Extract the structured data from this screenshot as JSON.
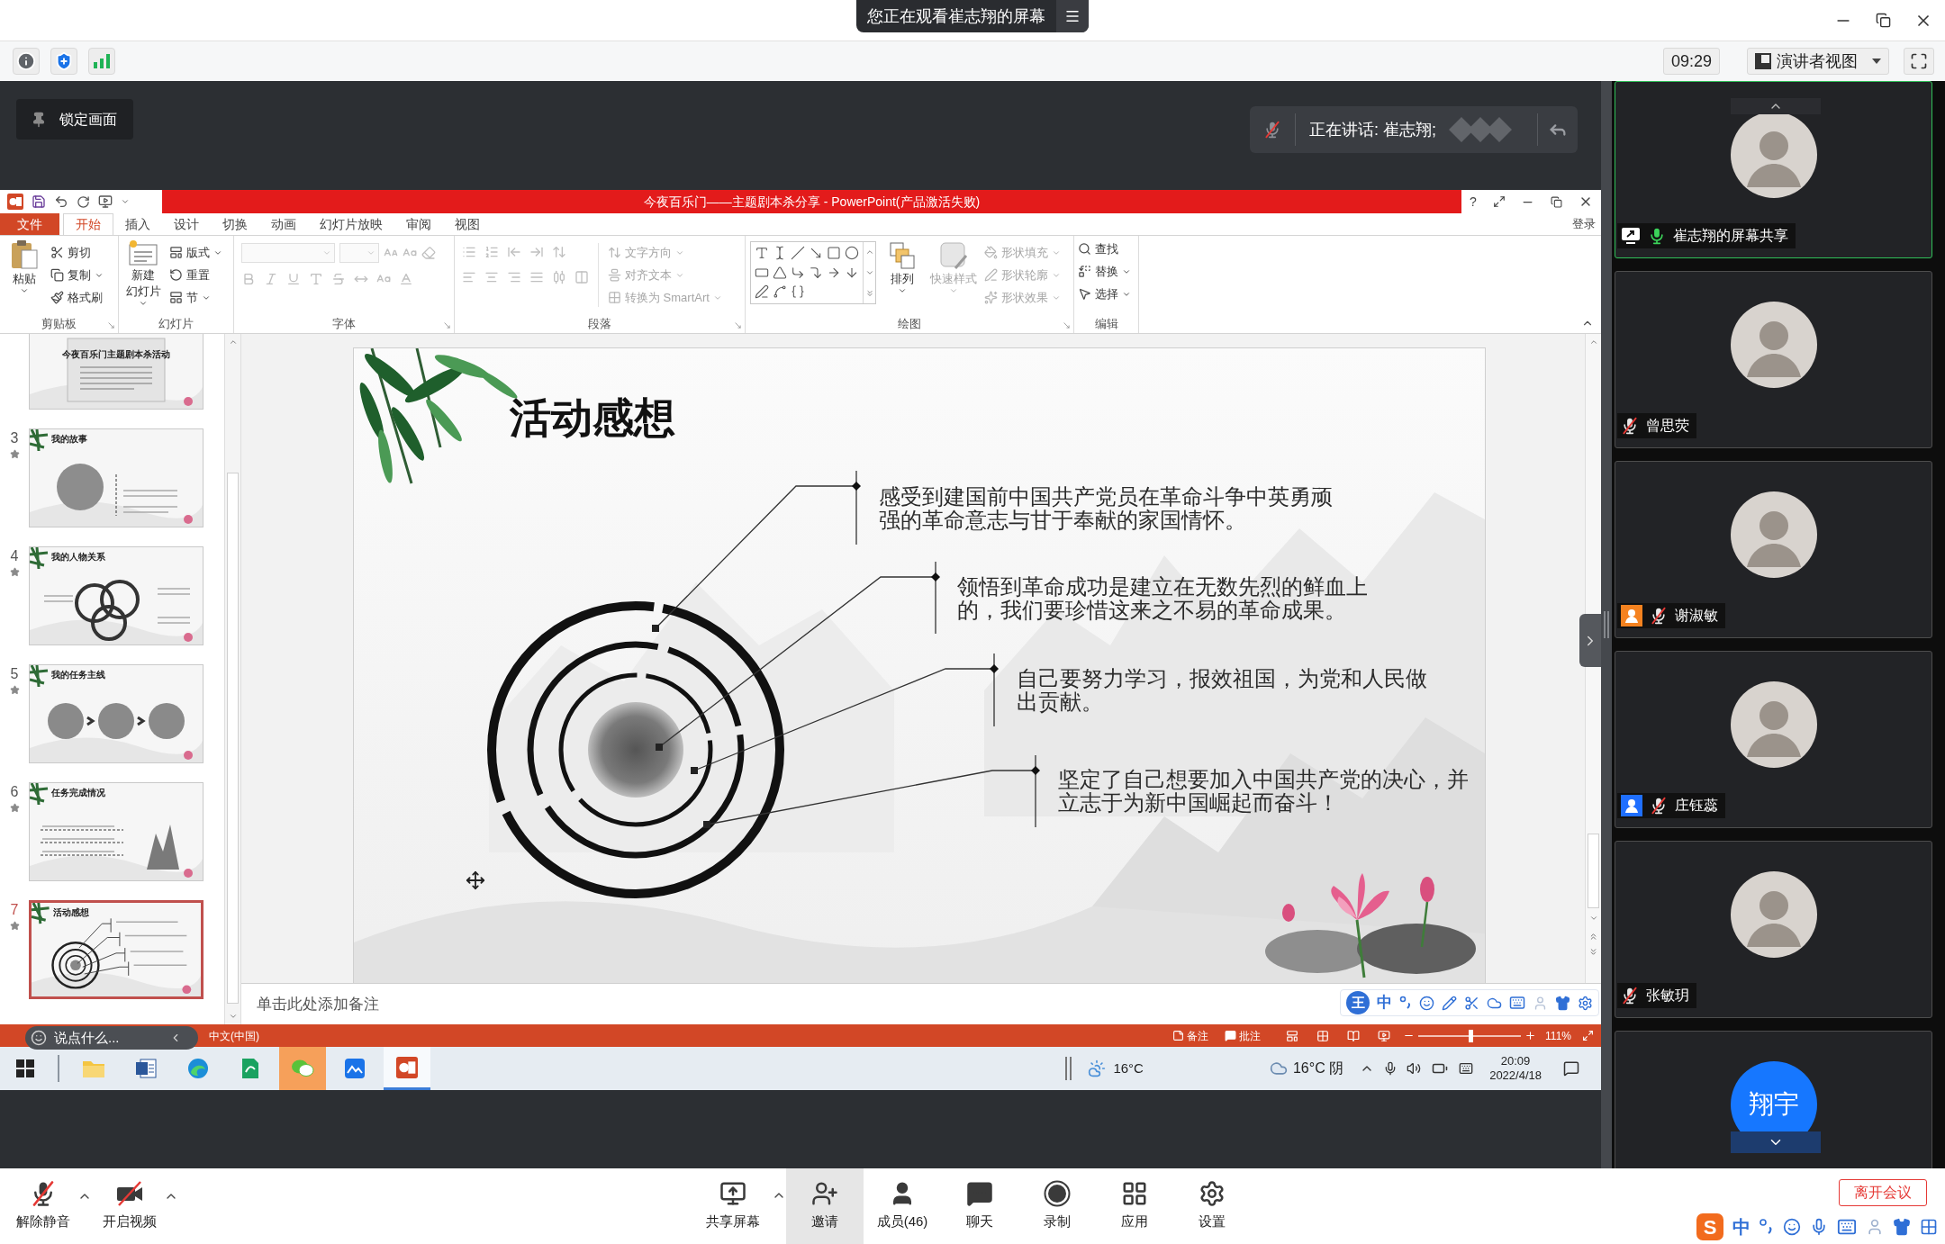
{
  "banner": {
    "text": "您正在观看崔志翔的屏幕"
  },
  "toolbar": {
    "time": "09:29",
    "view_menu": "演讲者视图"
  },
  "lock_button": "锁定画面",
  "speaker": {
    "text": "正在讲话: 崔志翔;",
    "muted": true
  },
  "powerpoint": {
    "title": "今夜百乐门——主题剧本杀分享 - PowerPoint(产品激活失败)",
    "help": "?",
    "tabs": [
      {
        "label": "文件",
        "kind": "file",
        "selected": false
      },
      {
        "label": "开始",
        "kind": "tab",
        "selected": true
      },
      {
        "label": "插入",
        "kind": "tab",
        "selected": false
      },
      {
        "label": "设计",
        "kind": "tab",
        "selected": false
      },
      {
        "label": "切换",
        "kind": "tab",
        "selected": false
      },
      {
        "label": "动画",
        "kind": "tab",
        "selected": false
      },
      {
        "label": "幻灯片放映",
        "kind": "tab",
        "selected": false
      },
      {
        "label": "审阅",
        "kind": "tab",
        "selected": false
      },
      {
        "label": "视图",
        "kind": "tab",
        "selected": false
      }
    ],
    "sign_in": "登录",
    "ribbon": [
      {
        "kind": "clipboard",
        "label": "剪贴板",
        "disabled": false,
        "large": [
          "粘贴"
        ],
        "items": [
          {
            "label": "剪切",
            "kind": "cut",
            "menu": false,
            "disabled": false
          },
          {
            "label": "复制",
            "kind": "copy",
            "menu": true,
            "disabled": false
          },
          {
            "label": "格式刷",
            "kind": "brush",
            "menu": false,
            "disabled": false
          }
        ]
      },
      {
        "kind": "slides",
        "label": "幻灯片",
        "disabled": false,
        "large": [
          "新建",
          "幻灯片"
        ],
        "items": [
          {
            "label": "版式",
            "kind": "layout",
            "menu": true,
            "disabled": false
          },
          {
            "label": "重置",
            "kind": "reset",
            "menu": false,
            "disabled": false
          },
          {
            "label": "节",
            "kind": "section",
            "menu": true,
            "disabled": false
          }
        ]
      },
      {
        "kind": "font",
        "label": "字体",
        "disabled": true
      },
      {
        "kind": "paragraph",
        "label": "段落",
        "disabled": true,
        "items": [
          {
            "label": "文字方向",
            "kind": "text-direction",
            "menu": true,
            "disabled": true
          },
          {
            "label": "对齐文本",
            "kind": "align-text",
            "menu": true,
            "disabled": true
          },
          {
            "label": "转换为 SmartArt",
            "kind": "smartart",
            "menu": true,
            "disabled": true
          }
        ]
      },
      {
        "kind": "drawing",
        "label": "绘图",
        "disabled": false,
        "large": [
          "排列"
        ],
        "quick_styles": {
          "label": "快速样式",
          "disabled": true
        },
        "items": [
          {
            "label": "形状填充",
            "kind": "fill",
            "menu": true,
            "disabled": true
          },
          {
            "label": "形状轮廓",
            "kind": "outline",
            "menu": true,
            "disabled": true
          },
          {
            "label": "形状效果",
            "kind": "effects",
            "menu": true,
            "disabled": true
          }
        ]
      },
      {
        "kind": "editing",
        "label": "编辑",
        "items": [
          {
            "label": "查找",
            "kind": "find",
            "menu": false,
            "disabled": false
          },
          {
            "label": "替换",
            "kind": "replace",
            "menu": true,
            "disabled": false
          },
          {
            "label": "选择",
            "kind": "select",
            "menu": true,
            "disabled": false
          }
        ]
      }
    ],
    "thumbnails": [
      {
        "title": "今夜百乐门主题剧本杀活动",
        "kind": "scroll",
        "selected": false
      },
      {
        "number": "3",
        "title": "我的故事",
        "kind": "circle",
        "selected": false,
        "animated": true
      },
      {
        "number": "4",
        "title": "我的人物关系",
        "kind": "rings",
        "selected": false,
        "animated": true
      },
      {
        "number": "5",
        "title": "我的任务主线",
        "kind": "chain",
        "selected": false,
        "animated": true
      },
      {
        "number": "6",
        "title": "任务完成情况",
        "kind": "list",
        "selected": false,
        "animated": true
      },
      {
        "number": "7",
        "title": "活动感想",
        "kind": "target",
        "selected": true,
        "animated": true
      }
    ],
    "slide": {
      "title": "活动感想",
      "points": [
        "感受到建国前中国共产党员在革命斗争中英勇顽强的革命意志与甘于奉献的家国情怀。",
        "领悟到革命成功是建立在无数先烈的鲜血上的，我们要珍惜这来之不易的革命成果。",
        "自己要努力学习，报效祖国，为党和人民做出贡献。",
        "坚定了自己想要加入中国共产党的决心，并立志于为新中国崛起而奋斗！"
      ]
    },
    "notes_placeholder": "单击此处添加备注",
    "status_bar": {
      "language": "中文(中国)",
      "notes": "备注",
      "comments": "批注",
      "zoom": {
        "level": 0.51,
        "reading": "111%"
      }
    }
  },
  "ime_toolbar": {
    "logo": "王",
    "mode": "中"
  },
  "chat_box": {
    "placeholder": "说点什么..."
  },
  "taskbar": {
    "apps": [
      {
        "kind": "explorer",
        "active": false,
        "flashing": false
      },
      {
        "kind": "word",
        "active": false,
        "flashing": false
      },
      {
        "kind": "edge",
        "active": false,
        "flashing": false
      },
      {
        "kind": "pdf",
        "active": false,
        "flashing": false
      },
      {
        "kind": "wechat",
        "active": false,
        "flashing": true
      },
      {
        "kind": "board",
        "active": false,
        "flashing": false
      },
      {
        "kind": "powerpoint",
        "active": true,
        "flashing": false
      }
    ],
    "weather_widget": "16°C",
    "weather": "16°C 阴",
    "time": "20:09",
    "date": "2022/4/18"
  },
  "participants": [
    {
      "name": "崔志翔的屏幕共享",
      "kind": "screen_share",
      "muted": false,
      "active": true
    },
    {
      "name": "曾思荧",
      "kind": "user",
      "muted": true,
      "active": false
    },
    {
      "name": "谢淑敏",
      "kind": "guest",
      "color": "#f5821f",
      "muted": true,
      "active": false
    },
    {
      "name": "庄钰蕊",
      "kind": "guest",
      "color": "#1f6fff",
      "muted": true,
      "active": false
    },
    {
      "name": "张敏玥",
      "kind": "user",
      "muted": true,
      "active": false
    },
    {
      "kind": "initials",
      "initials": "翔宇",
      "active": false
    }
  ],
  "bottom_bar": {
    "left": [
      {
        "label": "解除静音",
        "kind": "unmute",
        "menu": true
      },
      {
        "label": "开启视频",
        "kind": "video",
        "menu": true
      }
    ],
    "center": [
      {
        "label": "共享屏幕",
        "kind": "share",
        "menu": true,
        "selected": false
      },
      {
        "label": "邀请",
        "kind": "invite",
        "menu": false,
        "selected": true
      },
      {
        "label": "成员(46)",
        "kind": "members",
        "menu": false,
        "selected": false
      },
      {
        "label": "聊天",
        "kind": "chat",
        "menu": false,
        "selected": false
      },
      {
        "label": "录制",
        "kind": "record",
        "menu": false,
        "selected": false
      },
      {
        "label": "应用",
        "kind": "apps",
        "menu": false,
        "selected": false
      },
      {
        "label": "设置",
        "kind": "settings",
        "menu": false,
        "selected": false
      }
    ],
    "leave": "离开会议"
  },
  "sogou": {
    "logo": "S",
    "mode": "中"
  }
}
